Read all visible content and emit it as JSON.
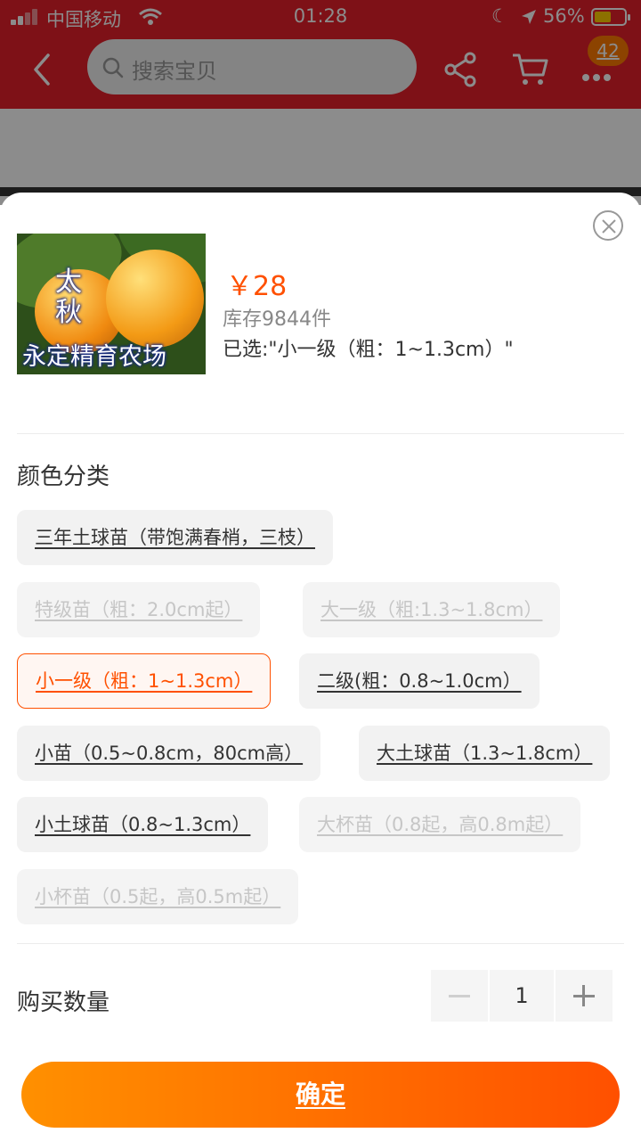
{
  "status_bar": {
    "carrier": "中国移动",
    "time": "01:28",
    "battery_percent": "56%"
  },
  "nav": {
    "search_placeholder": "搜索宝贝",
    "badge_count": "42"
  },
  "product": {
    "image_text_top": "太\n秋",
    "image_text_bottom": "永定精育农场",
    "price": "￥28",
    "stock": "库存9844件",
    "selected": "已选:\"小一级（粗：1~1.3cm）\""
  },
  "spec": {
    "title": "颜色分类",
    "options": [
      {
        "label": "三年土球苗（带饱满春梢，三枝）",
        "state": "normal"
      },
      {
        "label": "特级苗（粗：2.0cm起）",
        "state": "disabled"
      },
      {
        "label": "大一级（粗:1.3~1.8cm）",
        "state": "disabled"
      },
      {
        "label": "小一级（粗：1~1.3cm）",
        "state": "selected"
      },
      {
        "label": "二级(粗：0.8~1.0cm）",
        "state": "normal"
      },
      {
        "label": "小苗（0.5~0.8cm，80cm高）",
        "state": "normal"
      },
      {
        "label": "大土球苗（1.3~1.8cm）",
        "state": "normal"
      },
      {
        "label": "小土球苗（0.8~1.3cm）",
        "state": "normal"
      },
      {
        "label": "大杯苗（0.8起，高0.8m起）",
        "state": "disabled"
      },
      {
        "label": "小杯苗（0.5起，高0.5m起）",
        "state": "disabled"
      }
    ]
  },
  "quantity": {
    "label": "购买数量",
    "value": "1"
  },
  "confirm_label": "确定",
  "colors": {
    "accent": "#ff5000",
    "gradient_start": "#ff9000",
    "nav_red": "#e5202b"
  }
}
